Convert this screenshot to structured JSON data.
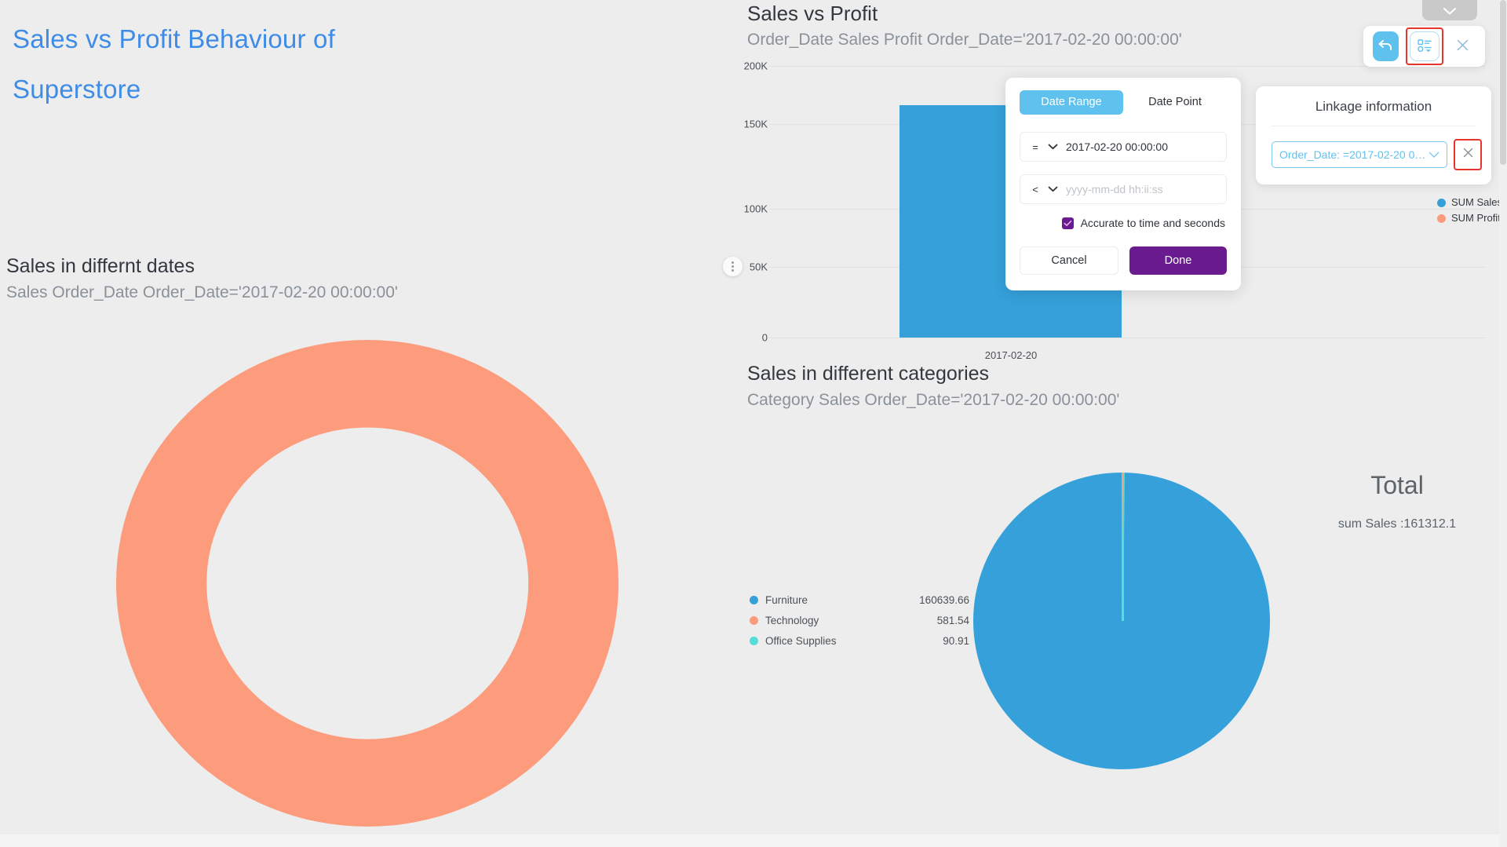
{
  "dashboard": {
    "title": "Sales vs Profit Behaviour of Superstore"
  },
  "panels": {
    "donut": {
      "title": "Sales in differnt dates",
      "subtitle": "Sales Order_Date Order_Date='2017-02-20 00:00:00'"
    },
    "bar": {
      "title": "Sales vs Profit",
      "subtitle": "Order_Date Sales Profit Order_Date='2017-02-20 00:00:00'"
    },
    "pie": {
      "title": "Sales in different categories",
      "subtitle": "Category Sales Order_Date='2017-02-20 00:00:00'"
    },
    "total": {
      "title": "Total",
      "value_label": "sum Sales :161312.1"
    }
  },
  "toolbar": {
    "undo_icon": "undo-arrow-icon",
    "linkage_icon": "linkage-settings-icon",
    "close_icon": "close-icon",
    "collapse_icon": "chevron-down-icon"
  },
  "linkage": {
    "title": "Linkage information",
    "filter_label": "Order_Date: =2017-02-20 00:00:...",
    "caret_icon": "chevron-down-icon",
    "remove_icon": "close-icon"
  },
  "date_dialog": {
    "tabs": [
      {
        "label": "Date Range",
        "active": true
      },
      {
        "label": "Date Point",
        "active": false
      }
    ],
    "row1": {
      "operator": "=",
      "value": "2017-02-20 00:00:00",
      "placeholder": "yyyy-mm-dd hh:ii:ss"
    },
    "row2": {
      "operator": "<",
      "value": "",
      "placeholder": "yyyy-mm-dd hh:ii:ss"
    },
    "checkbox": {
      "label": "Accurate to time and seconds",
      "checked": true
    },
    "cancel_label": "Cancel",
    "done_label": "Done",
    "accent_color": "#6a1b8f",
    "tab_active_color": "#5fc2ee"
  },
  "chart_data": [
    {
      "type": "bar",
      "title": "Sales vs Profit",
      "subtitle": "Order_Date Sales Profit Order_Date='2017-02-20 00:00:00'",
      "categories": [
        "2017-02-20"
      ],
      "xlabel": "",
      "ylabel": "",
      "ylim": [
        0,
        200000
      ],
      "yticks": [
        "0",
        "50K",
        "100K",
        "150K",
        "200K"
      ],
      "ytick_values": [
        0,
        50000,
        100000,
        150000,
        200000
      ],
      "grid": true,
      "legend_position": "right",
      "series": [
        {
          "name": "SUM Sales",
          "values": [
            161312.1
          ],
          "color": "#35a0d9"
        },
        {
          "name": "SUM Profit",
          "values": [
            0
          ],
          "color": "#fc9c7c"
        }
      ]
    },
    {
      "type": "pie",
      "title": "Sales in differnt dates",
      "subtitle": "Sales Order_Date Order_Date='2017-02-20 00:00:00'",
      "donut": true,
      "categories": [
        "2017-02-20"
      ],
      "values": [
        161312.1
      ],
      "colors": [
        "#fc9c7c"
      ]
    },
    {
      "type": "pie",
      "title": "Sales in different categories",
      "subtitle": "Category Sales Order_Date='2017-02-20 00:00:00'",
      "categories": [
        "Furniture",
        "Technology",
        "Office Supplies"
      ],
      "values": [
        160639.66,
        581.54,
        90.91
      ],
      "value_labels": [
        "160639.66",
        "581.54",
        "90.91"
      ],
      "colors": [
        "#35a0d9",
        "#fc9c7c",
        "#55ddd9"
      ],
      "legend_position": "left"
    }
  ]
}
